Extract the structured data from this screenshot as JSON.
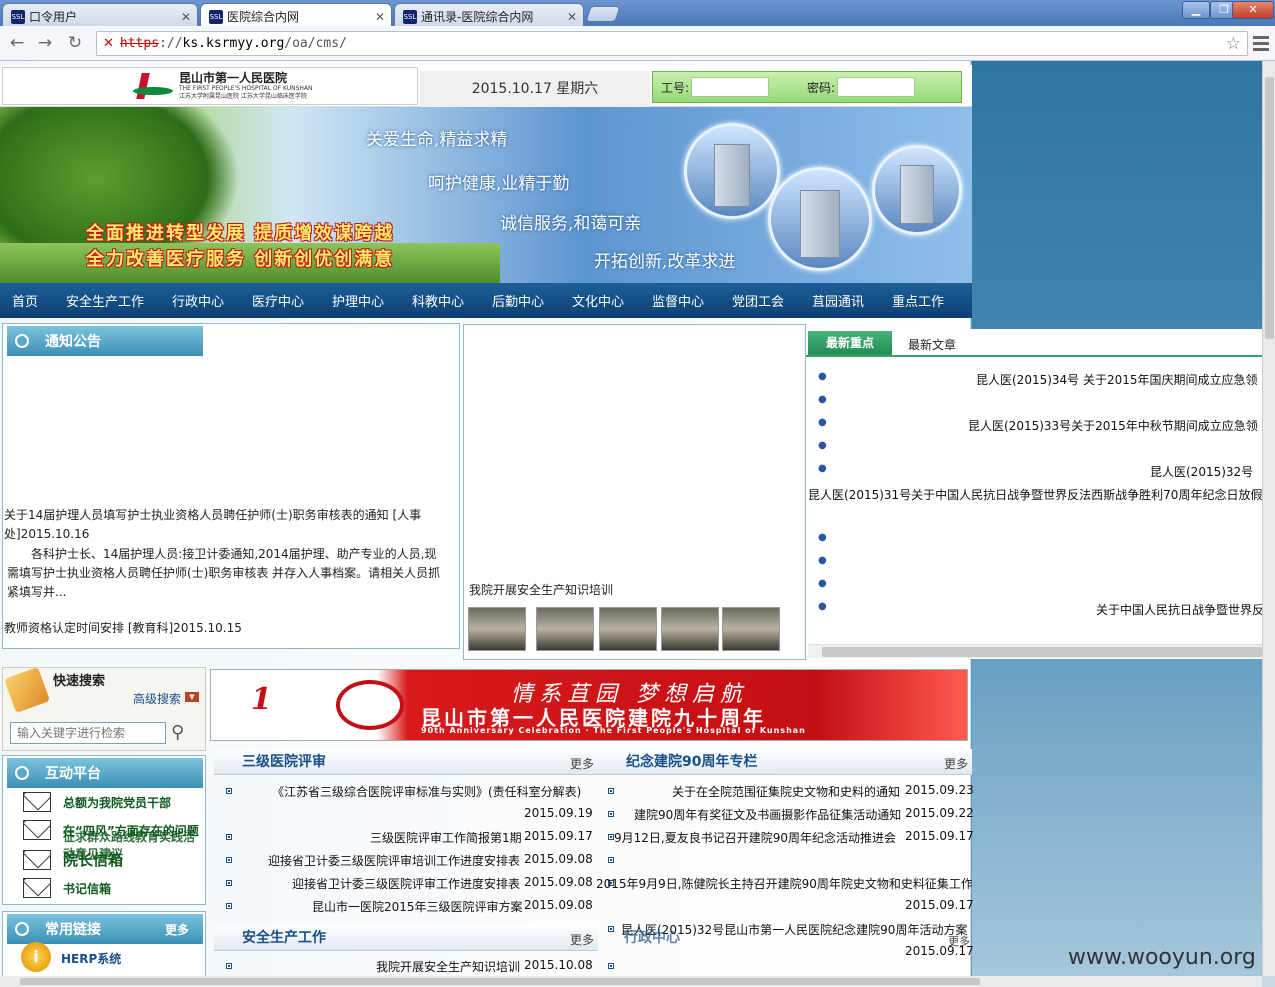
{
  "browser": {
    "tabs": [
      {
        "label": "口令用户",
        "favicon": "ssl"
      },
      {
        "label": "医院综合内网",
        "favicon": "ssl",
        "active": true
      },
      {
        "label": "通讯录-医院综合内网",
        "favicon": "ssl"
      }
    ],
    "url": {
      "scheme": "https",
      "host": "ks.ksrmyy.org",
      "path": "/oa/cms/"
    },
    "icons": [
      "back-icon",
      "forward-icon",
      "reload-icon",
      "insecure-lock-icon",
      "star-icon",
      "menu-icon"
    ]
  },
  "header": {
    "logo_name": "昆山市第一人民医院",
    "logo_sub1": "THE FIRST PEOPLE'S HOSPITAL OF KUNSHAN",
    "logo_sub2": "江苏大学附属昆山医院 江苏大学昆山临床医学院",
    "date": "2015.10.17 星期六",
    "login": {
      "id_label": "工号:",
      "pwd_label": "密码:"
    }
  },
  "banner": {
    "slogan1": "全面推进转型发展 提质增效谋跨越",
    "slogan2": "全力改善医疗服务 创新创优创满意",
    "motto1": "关爱生命,精益求精",
    "motto2": "呵护健康,业精于勤",
    "motto3": "诚信服务,和蔼可亲",
    "motto4": "开拓创新,改革求进"
  },
  "nav": [
    "首页",
    "安全生产工作",
    "行政中心",
    "医疗中心",
    "护理中心",
    "科教中心",
    "后勤中心",
    "文化中心",
    "监督中心",
    "党团工会",
    "苴园通讯",
    "重点工作"
  ],
  "notice": {
    "title": "通知公告",
    "item1_title": "关于14届护理人员填写护士执业资格人员聘任护师(士)职务审核表的通知 [人事",
    "item1_title2": "处]2015.10.16",
    "item1_body1": "各科护士长、14届护理人员:接卫计委通知,2014届护理、助产专业的人员,现",
    "item1_body2": "需填写护士执业资格人员聘任护师(士)职务审核表 并存入人事档案。请相关人员抓",
    "item1_body3": "紧填写并...",
    "item2": "教师资格认定时间安排 [教育科]2015.10.15"
  },
  "photos": {
    "caption": "我院开展安全生产知识培训"
  },
  "latest": {
    "tab_focus": "最新重点",
    "tab_articles": "最新文章",
    "items": [
      "昆人医(2015)34号 关于2015年国庆期间成立应急领",
      "昆人医(2015)33号关于2015年中秋节期间成立应急领",
      "昆人医(2015)32号",
      "昆人医(2015)31号关于中国人民抗日战争暨世界反法西斯战争胜利70周年纪念日放假",
      "关于中国人民抗日战争暨世界反"
    ]
  },
  "quick_search": {
    "title": "快速搜索",
    "advanced": "高级搜索",
    "placeholder": "输入关键字进行检索"
  },
  "interact": {
    "title": "互动平台",
    "items": [
      "总额为我院党员干部",
      "在“四风”方面存在的问题",
      "院长信箱",
      "书记信箱"
    ],
    "overlap1": "征求群众路线教育实践活动意见建议"
  },
  "links": {
    "title": "常用链接",
    "more": "更多",
    "herp": "HERP系统"
  },
  "anniversary": {
    "line1": "情系苴园 梦想启航",
    "line2": "昆山市第一人民医院建院九十周年",
    "line3": "90th Anniversary Celebration · The First People's Hospital of Kunshan"
  },
  "list_a": {
    "title": "三级医院评审",
    "more": "更多",
    "items": [
      {
        "t": "《江苏省三级综合医院评审标准与实则》(责任科室分解表)",
        "d": ""
      },
      {
        "t": "",
        "d": "2015.09.19"
      },
      {
        "t": "三级医院评审工作简报第1期",
        "d": "2015.09.17"
      },
      {
        "t": "迎接省卫计委三级医院评审培训工作进度安排表",
        "d": "2015.09.08"
      },
      {
        "t": "迎接省卫计委三级医院评审工作进度安排表",
        "d": "2015.09.08"
      },
      {
        "t": "昆山市一医院2015年三级医院评审方案",
        "d": "2015.09.08"
      }
    ]
  },
  "list_b": {
    "title": "纪念建院90周年专栏",
    "more": "更多",
    "items": [
      {
        "t": "关于在全院范围征集院史文物和史料的通知",
        "d": "2015.09.23"
      },
      {
        "t": "建院90周年有奖征文及书画摄影作品征集活动通知",
        "d": "2015.09.22"
      },
      {
        "t": "9月12日,夏友良书记召开建院90周年纪念活动推进会",
        "d": "2015.09.17"
      },
      {
        "t": "",
        "d": ""
      },
      {
        "t": "2015年9月9日,陈健院长主持召开建院90周年院史文物和史料征集工作",
        "d": ""
      },
      {
        "t": "",
        "d": "2015.09.17"
      },
      {
        "t": "昆人医(2015)32号昆山市第一人民医院纪念建院90周年活动方案",
        "d": "2015.09.17"
      }
    ]
  },
  "list_c": {
    "title": "安全生产工作",
    "more": "更多",
    "items": [
      {
        "t": "我院开展安全生产知识培训",
        "d": "2015.10.08"
      }
    ]
  },
  "list_d": {
    "title": "行政中心",
    "more": "更多"
  },
  "watermark": "www.wooyun.org"
}
